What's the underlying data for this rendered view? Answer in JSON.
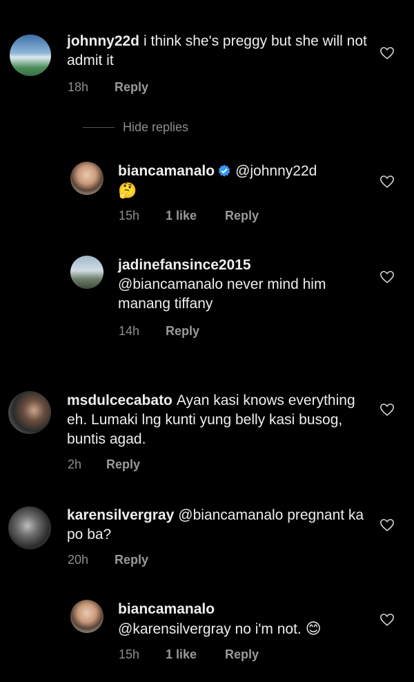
{
  "comments": [
    {
      "username": "johnny22d",
      "text": "i think she's preggy but she will not admit it",
      "time": "18h",
      "reply": "Reply"
    },
    {
      "hide_replies": "Hide replies"
    },
    {
      "username": "biancamanalo",
      "mention": "@johnny22d",
      "emoji": "🤔",
      "time": "15h",
      "likes": "1 like",
      "reply": "Reply"
    },
    {
      "username": "jadinefansince2015",
      "text": "@biancamanalo never mind him manang tiffany",
      "time": "14h",
      "reply": "Reply"
    },
    {
      "username": "msdulcecabato",
      "text": "Ayan kasi knows everything eh.  Lumaki lng kunti yung belly kasi busog, buntis agad.",
      "time": "2h",
      "reply": "Reply"
    },
    {
      "username": "karensilvergray",
      "text": "@biancamanalo pregnant ka po ba?",
      "time": "20h",
      "reply": "Reply"
    },
    {
      "username": "biancamanalo",
      "text": "@karensilvergray no i'm not.",
      "emoji": "😊",
      "time": "15h",
      "likes": "1 like",
      "reply": "Reply"
    }
  ]
}
